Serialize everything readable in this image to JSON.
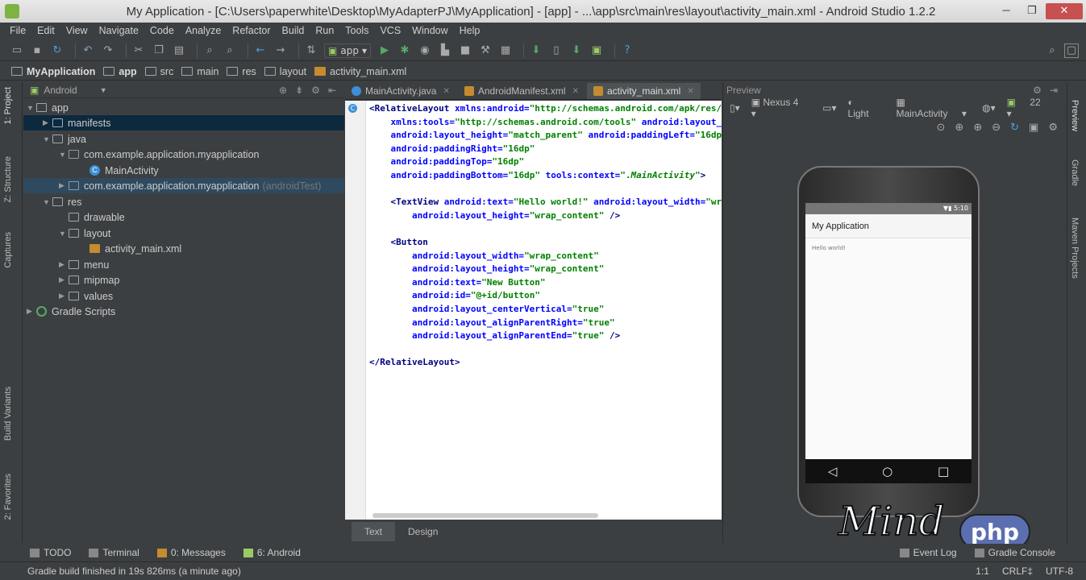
{
  "window": {
    "title": "My Application - [C:\\Users\\paperwhite\\Desktop\\MyAdapterPJ\\MyApplication] - [app] - ...\\app\\src\\main\\res\\layout\\activity_main.xml - Android Studio 1.2.2",
    "minimize": "─",
    "maximize": "❐",
    "close": "✕"
  },
  "menu": [
    "File",
    "Edit",
    "View",
    "Navigate",
    "Code",
    "Analyze",
    "Refactor",
    "Build",
    "Run",
    "Tools",
    "VCS",
    "Window",
    "Help"
  ],
  "toolbar": {
    "run_config": "app"
  },
  "breadcrumbs": [
    "MyApplication",
    "app",
    "src",
    "main",
    "res",
    "layout",
    "activity_main.xml"
  ],
  "left_tabs": {
    "project": "1: Project",
    "structure": "Z: Structure",
    "captures": "Captures",
    "build_variants": "Build Variants",
    "favorites": "2: Favorites"
  },
  "right_tabs": {
    "preview": "Preview",
    "gradle": "Gradle",
    "maven": "Maven Projects"
  },
  "project": {
    "view_mode": "Android",
    "tree": [
      {
        "label": "app",
        "extra": ""
      },
      {
        "label": "manifests",
        "extra": ""
      },
      {
        "label": "java",
        "extra": ""
      },
      {
        "label": "com.example.application.myapplication",
        "extra": ""
      },
      {
        "label": "MainActivity",
        "extra": ""
      },
      {
        "label": "com.example.application.myapplication",
        "extra": "(androidTest)"
      },
      {
        "label": "res",
        "extra": ""
      },
      {
        "label": "drawable",
        "extra": ""
      },
      {
        "label": "layout",
        "extra": ""
      },
      {
        "label": "activity_main.xml",
        "extra": ""
      },
      {
        "label": "menu",
        "extra": ""
      },
      {
        "label": "mipmap",
        "extra": ""
      },
      {
        "label": "values",
        "extra": ""
      },
      {
        "label": "Gradle Scripts",
        "extra": ""
      }
    ]
  },
  "editor": {
    "tabs": [
      "MainActivity.java",
      "AndroidManifest.xml",
      "activity_main.xml"
    ],
    "bottom_tabs": [
      "Text",
      "Design"
    ]
  },
  "preview": {
    "header": "Preview",
    "device": "Nexus 4",
    "theme": "Light",
    "activity": "MainActivity",
    "api": "22",
    "phone": {
      "time": "5:10",
      "app_title": "My Application",
      "content": "Hello world!"
    }
  },
  "logo": {
    "text1": "Mind",
    "text2": "php"
  },
  "tool_windows": [
    "TODO",
    "Terminal",
    "0: Messages",
    "6: Android",
    "Event Log",
    "Gradle Console"
  ],
  "status": {
    "message": "Gradle build finished in 19s 826ms (a minute ago)",
    "position": "1:1",
    "line_sep": "CRLF‡",
    "encoding": "UTF-8"
  }
}
